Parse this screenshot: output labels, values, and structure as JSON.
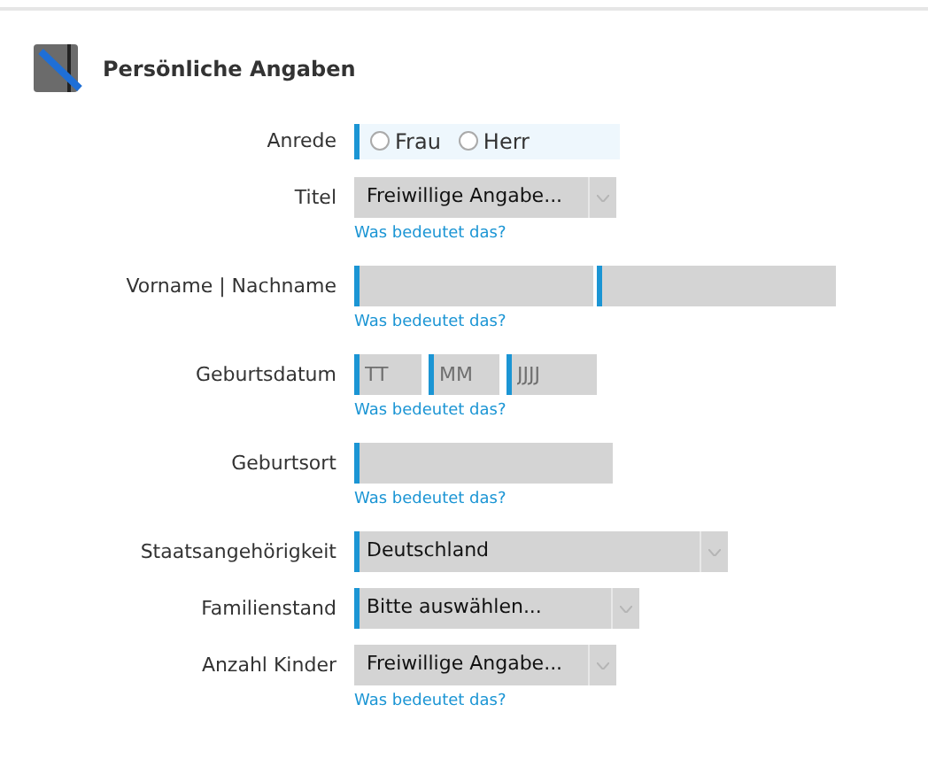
{
  "section": {
    "title": "Persönliche Angaben"
  },
  "fields": [
    {
      "kind": "radio",
      "label": "Anrede",
      "required": true,
      "options": [
        {
          "label": "Frau",
          "selected": false
        },
        {
          "label": "Herr",
          "selected": false
        }
      ]
    },
    {
      "kind": "select",
      "label": "Titel",
      "required": false,
      "value": "Freiwillige Angabe...",
      "help": "Was bedeutet das?"
    },
    {
      "kind": "name",
      "label": "Vorname | Nachname",
      "required": true,
      "help": "Was bedeutet das?"
    },
    {
      "kind": "date",
      "label": "Geburtsdatum",
      "required": true,
      "placeholders": [
        "TT",
        "MM",
        "JJJJ"
      ],
      "help": "Was bedeutet das?"
    },
    {
      "kind": "text",
      "label": "Geburtsort",
      "required": true,
      "help": "Was bedeutet das?"
    },
    {
      "kind": "select",
      "label": "Staatsangehörigkeit",
      "required": true,
      "value": "Deutschland"
    },
    {
      "kind": "select",
      "label": "Familienstand",
      "required": true,
      "value": "Bitte auswählen..."
    },
    {
      "kind": "select",
      "label": "Anzahl Kinder",
      "required": false,
      "value": "Freiwillige Angabe...",
      "help": "Was bedeutet das?"
    }
  ]
}
